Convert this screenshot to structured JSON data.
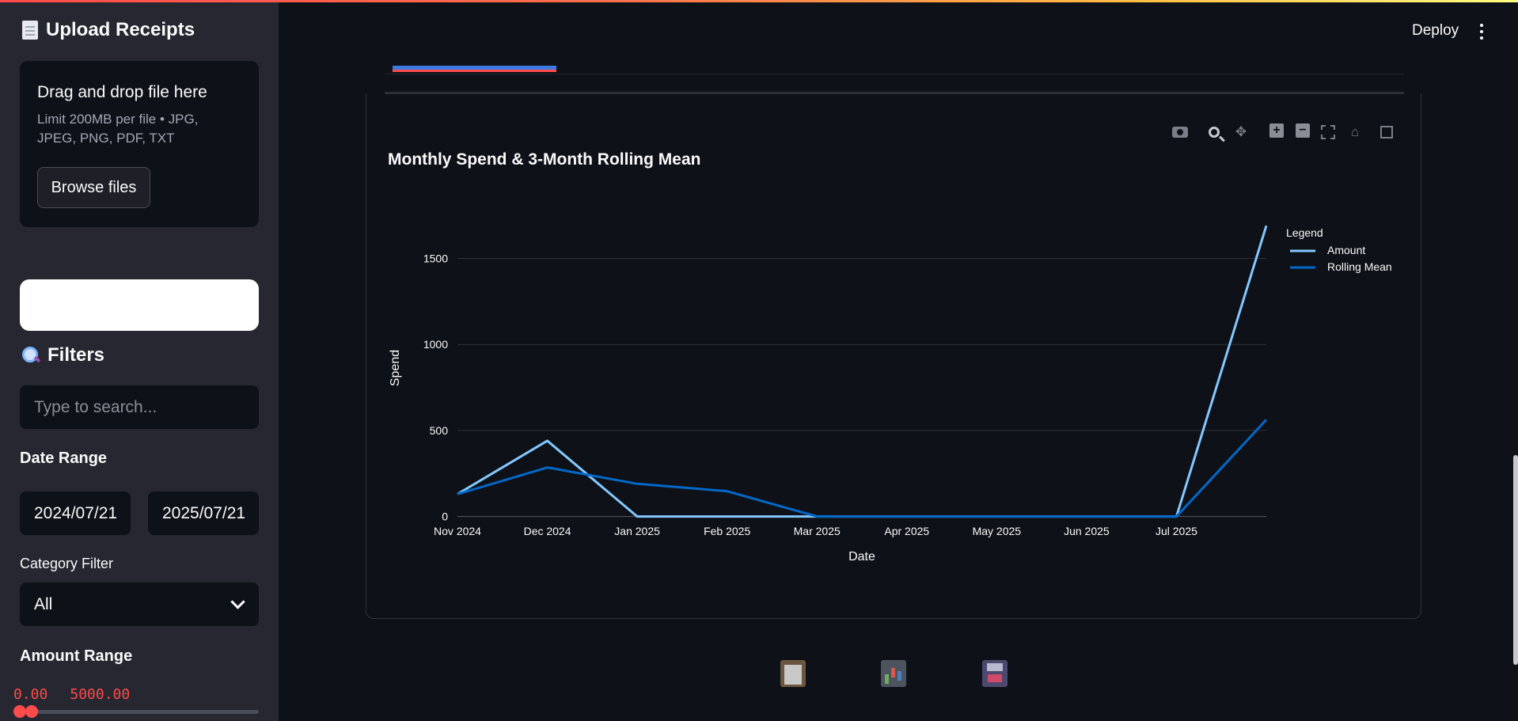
{
  "sidebar": {
    "upload_title": "Upload Receipts",
    "upload_icon": "document-icon",
    "dropzone": {
      "title": "Drag and drop file here",
      "limits": "Limit 200MB per file • JPG, JPEG, PNG, PDF, TXT",
      "browse_label": "Browse files"
    },
    "filters_title": "Filters",
    "filters_icon": "magnifier-icon",
    "search": {
      "placeholder": "Type to search..."
    },
    "date_range": {
      "label": "Date Range",
      "from": "2024/07/21",
      "to": "2025/07/21"
    },
    "category": {
      "label": "Category Filter",
      "value": "All"
    },
    "amount_range": {
      "label": "Amount Range",
      "min": "0.00",
      "max": "5000.00"
    }
  },
  "header": {
    "deploy_label": "Deploy",
    "menu_icon": "kebab-menu-icon"
  },
  "colors": {
    "accent": "#ff4b4b",
    "amount_line": "#83c9ff",
    "rolling_line": "#0068c9",
    "tab_indicator": "#3b7ae0"
  },
  "chart_data": {
    "type": "line",
    "title": "Monthly Spend & 3-Month Rolling Mean",
    "xlabel": "Date",
    "ylabel": "Spend",
    "x": [
      "2024-11-01",
      "2024-12-01",
      "2025-01-01",
      "2025-02-01",
      "2025-03-01",
      "2025-04-01",
      "2025-05-01",
      "2025-06-01",
      "2025-07-01",
      "2025-08-01"
    ],
    "xtick_labels": [
      "Nov 2024",
      "Dec 2024",
      "Jan 2025",
      "Feb 2025",
      "Mar 2025",
      "Apr 2025",
      "May 2025",
      "Jun 2025",
      "Jul 2025"
    ],
    "ytick_labels": [
      "0",
      "500",
      "1000",
      "1500"
    ],
    "yticks": [
      0,
      500,
      1000,
      1500
    ],
    "ylim": [
      -80,
      1760
    ],
    "grid": true,
    "legend": {
      "title": "Legend",
      "position": "top-right"
    },
    "series": [
      {
        "name": "Amount",
        "color": "#83c9ff",
        "values": [
          130,
          440,
          0,
          0,
          0,
          0,
          0,
          0,
          0,
          1690
        ]
      },
      {
        "name": "Rolling Mean",
        "color": "#0068c9",
        "values": [
          130,
          285,
          190,
          147,
          0,
          0,
          0,
          0,
          0,
          563
        ]
      }
    ]
  },
  "bottom_icons": [
    "clipboard-icon",
    "bar-chart-icon",
    "floppy-disk-icon"
  ]
}
